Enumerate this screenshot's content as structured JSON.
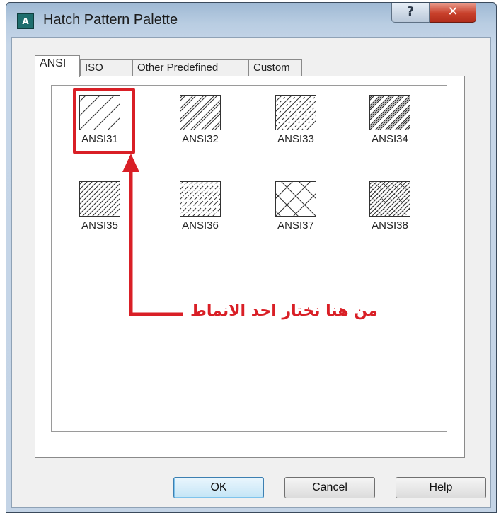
{
  "window": {
    "title": "Hatch Pattern Palette",
    "app_icon": "autocad-icon",
    "help_glyph": "?",
    "close_glyph": "✕"
  },
  "tabs": [
    {
      "label": "ANSI",
      "active": true
    },
    {
      "label": "ISO",
      "active": false
    },
    {
      "label": "Other Predefined",
      "active": false
    },
    {
      "label": "Custom",
      "active": false
    }
  ],
  "patterns": [
    {
      "label": "ANSI31",
      "selected": true
    },
    {
      "label": "ANSI32",
      "selected": false
    },
    {
      "label": "ANSI33",
      "selected": false
    },
    {
      "label": "ANSI34",
      "selected": false
    },
    {
      "label": "ANSI35",
      "selected": false
    },
    {
      "label": "ANSI36",
      "selected": false
    },
    {
      "label": "ANSI37",
      "selected": false
    },
    {
      "label": "ANSI38",
      "selected": false
    }
  ],
  "annotation": {
    "text": "من هنا نختار احد الانماط",
    "color": "#d91f26"
  },
  "buttons": {
    "ok": "OK",
    "cancel": "Cancel",
    "help": "Help"
  }
}
